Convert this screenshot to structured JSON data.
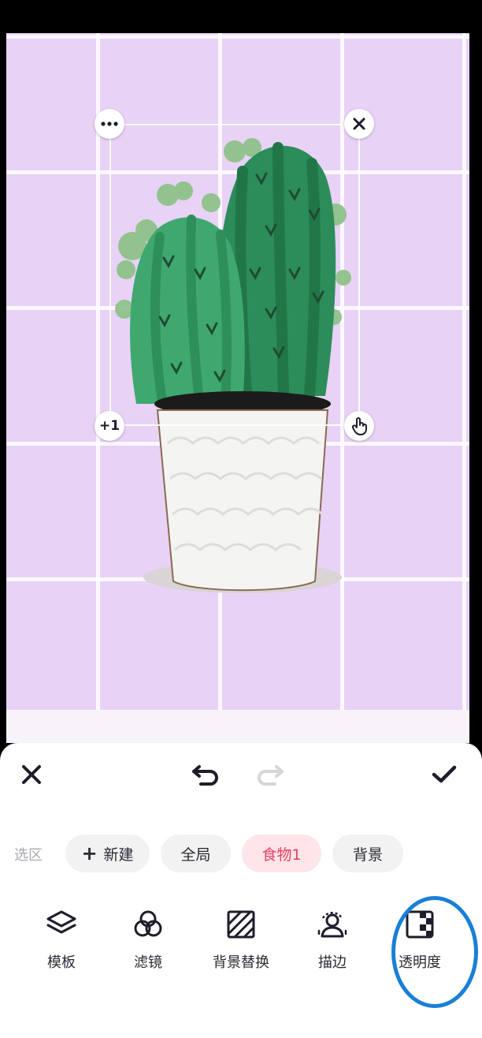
{
  "selection": {
    "more_icon": "more-dots-icon",
    "close_icon": "close-icon",
    "duplicate_label": "+1",
    "gesture_icon": "hand-pointer-icon"
  },
  "toolbar": {
    "close_icon": "close-icon",
    "undo_icon": "undo-icon",
    "redo_icon": "redo-icon",
    "confirm_icon": "checkmark-icon"
  },
  "selection_chips": {
    "label": "选区",
    "new_plus": "+",
    "new_label": "新建",
    "items": [
      "全局",
      "食物1",
      "背景"
    ],
    "active": "食物1"
  },
  "tools": [
    {
      "label": "模板",
      "icon": "layers-icon"
    },
    {
      "label": "滤镜",
      "icon": "filter-circles-icon"
    },
    {
      "label": "背景替换",
      "icon": "background-replace-icon"
    },
    {
      "label": "描边",
      "icon": "person-outline-icon"
    },
    {
      "label": "透明度",
      "icon": "transparency-icon"
    }
  ],
  "colors": {
    "canvas_bg": "#e8d2f6",
    "active_chip_bg": "#fde5ea",
    "active_chip_text": "#e8405e",
    "annotation_ring": "#1a7fd6",
    "cactus_green": "#2f9a63",
    "icon_dark": "#1d1d2b"
  }
}
